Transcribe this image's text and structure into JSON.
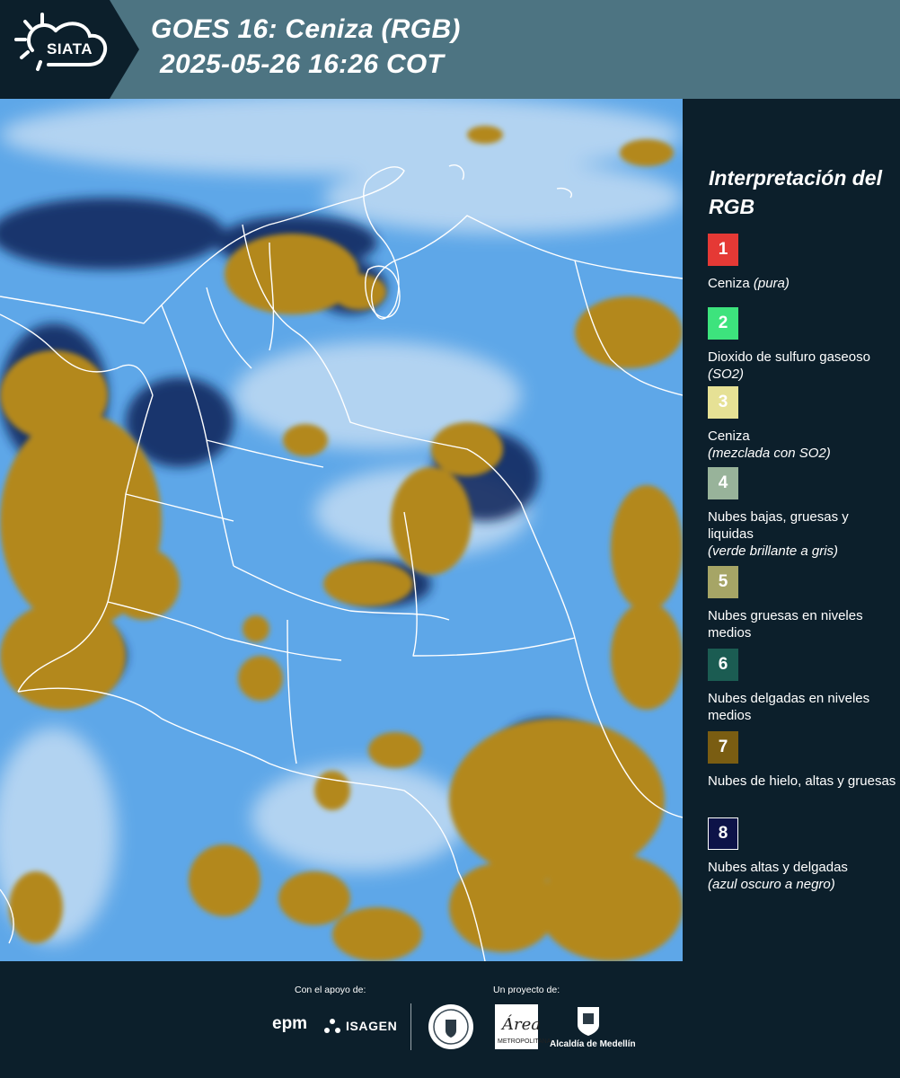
{
  "header": {
    "logo_text": "SIATA",
    "title_line1": "GOES 16: Ceniza (RGB)",
    "title_line2": "2025-05-26 16:26 COT"
  },
  "map": {
    "colors": {
      "background_blue": "#5fa6e6",
      "ice_cloud": "#b38a1f",
      "high_thin_cloud": "#0d1a4a",
      "border": "#ffffff"
    }
  },
  "legend": {
    "title": "Interpretación del RGB",
    "items": [
      {
        "num": "1",
        "color": "#e53935",
        "label": "Ceniza ",
        "note": "(pura)"
      },
      {
        "num": "2",
        "color": "#3de37d",
        "label": "Dioxido de sulfuro gaseoso ",
        "note": "(SO2)"
      },
      {
        "num": "3",
        "color": "#e6e195",
        "label": "Ceniza",
        "note": "(mezclada con SO2)"
      },
      {
        "num": "4",
        "color": "#98b39a",
        "label": "Nubes bajas, gruesas y liquidas",
        "note": "(verde brillante a gris)"
      },
      {
        "num": "5",
        "color": "#a6a566",
        "label": "Nubes gruesas en niveles medios",
        "note": ""
      },
      {
        "num": "6",
        "color": "#1b5c52",
        "label": "Nubes delgadas en niveles medios",
        "note": ""
      },
      {
        "num": "7",
        "color": "#7a5d12",
        "label": "Nubes de hielo, altas y gruesas",
        "note": ""
      },
      {
        "num": "8",
        "color": "#0d1348",
        "label": "Nubes altas y delgadas",
        "note": "(azul oscuro a negro)"
      }
    ]
  },
  "footer": {
    "support_label": "Con el apoyo de:",
    "project_label": "Un proyecto de:",
    "sponsor_1": "epm",
    "sponsor_2": "ISAGEN",
    "partner_area": "Área",
    "partner_area_sub": "METROPOLITANA",
    "partner_alcaldia": "Alcaldía de Medellín"
  }
}
